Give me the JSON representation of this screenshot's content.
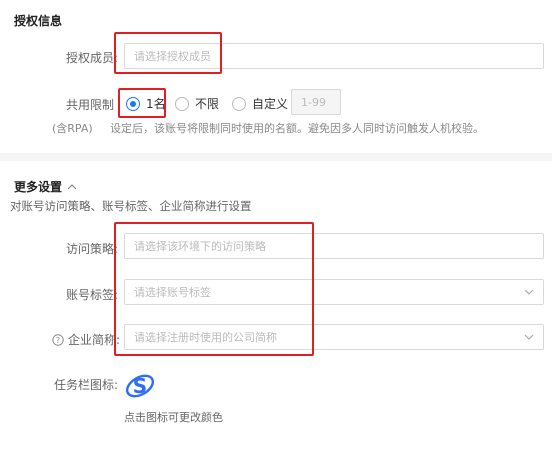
{
  "auth_section": {
    "title": "授权信息",
    "member_label": "授权成员:",
    "member_placeholder": "请选择授权成员",
    "share_label": "共用限制",
    "share_options": [
      "1名",
      "不限",
      "自定义"
    ],
    "custom_placeholder": "1-99",
    "rpa_label": "(含RPA)",
    "hint": "设定后，该账号将限制同时使用的名额。避免因多人同时访问触发人机校验。"
  },
  "more_section": {
    "title": "更多设置",
    "description": "对账号访问策略、账号标签、企业简称进行设置",
    "access_label": "访问策略:",
    "access_placeholder": "请选择该环境下的访问策略",
    "tag_label": "账号标签:",
    "tag_placeholder": "请选择账号标签",
    "company_label": "企业简称:",
    "company_placeholder": "请选择注册时使用的公司简称",
    "taskbar_label": "任务栏图标:",
    "taskbar_hint": "点击图标可更改颜色"
  },
  "colors": {
    "accent": "#1677ff",
    "highlight": "#e02020",
    "icon_bg": "#2f6df6"
  }
}
